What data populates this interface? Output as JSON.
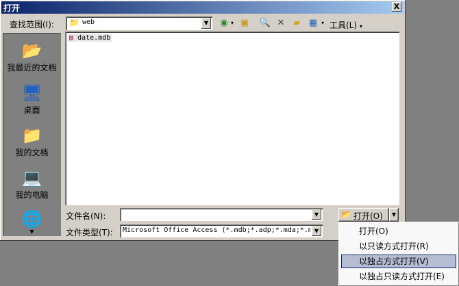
{
  "dialog": {
    "title": "打开",
    "close_glyph": "X",
    "look_in_label": "查找范围(I):",
    "look_in_value": "web",
    "tools_label": "工具(L)",
    "places": [
      {
        "label": "我最近的文档"
      },
      {
        "label": "桌面"
      },
      {
        "label": "我的文档"
      },
      {
        "label": "我的电脑"
      }
    ],
    "files": [
      {
        "name": "date.mdb"
      }
    ],
    "filename_label": "文件名(N):",
    "filename_value": "",
    "filetype_label": "文件类型(T):",
    "filetype_value": "Microsoft Office Access (*.mdb;*.adp;*.mda;*.md",
    "open_button": "打开(O)",
    "open_menu": [
      {
        "label": "打开(O)"
      },
      {
        "label": "以只读方式打开(R)"
      },
      {
        "label": "以独占方式打开(V)"
      },
      {
        "label": "以独占只读方式打开(E)"
      }
    ]
  },
  "colors": {
    "title_gradient_start": "#0a246a",
    "title_gradient_end": "#a6caf0",
    "face": "#d4d0c8",
    "menu_highlight": "#b6bdd2"
  }
}
